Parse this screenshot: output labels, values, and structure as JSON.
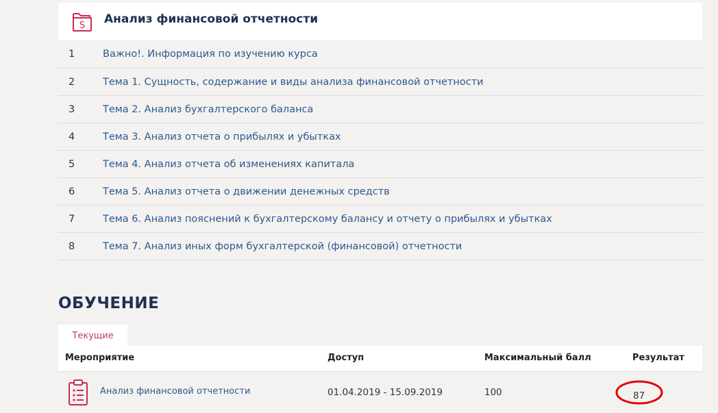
{
  "course": {
    "title": "Анализ финансовой отчетности",
    "icon": "course-s-icon",
    "accent": "#d0274c"
  },
  "topics": [
    {
      "num": "1",
      "label": "Важно!. Информация по изучению курса"
    },
    {
      "num": "2",
      "label": "Тема 1. Сущность, содержание и виды анализа финансовой отчетности"
    },
    {
      "num": "3",
      "label": "Тема 2. Анализ бухгалтерского баланса"
    },
    {
      "num": "4",
      "label": "Тема 3. Анализ отчета о прибылях и убытках"
    },
    {
      "num": "5",
      "label": "Тема 4. Анализ отчета об изменениях капитала"
    },
    {
      "num": "6",
      "label": "Тема 5. Анализ отчета о движении денежных средств"
    },
    {
      "num": "7",
      "label": "Тема 6. Анализ пояснений к бухгалтерскому балансу и отчету о прибылях и убытках"
    },
    {
      "num": "8",
      "label": "Тема 7. Анализ иных форм бухгалтерской (финансовой) отчетности"
    }
  ],
  "learning": {
    "section_title": "ОБУЧЕНИЕ",
    "tab_label": "Текущие",
    "columns": {
      "event": "Мероприятие",
      "access": "Доступ",
      "max_score": "Максимальный балл",
      "result": "Результат"
    },
    "rows": [
      {
        "event": "Анализ финансовой отчетности",
        "access": "01.04.2019 - 15.09.2019",
        "max_score": "100",
        "result": "87",
        "icon": "clipboard-list-icon"
      }
    ]
  },
  "colors": {
    "link": "#2b5a8c",
    "heading": "#1f3152",
    "tab_text": "#c43c5a",
    "highlight_circle": "#e00000"
  }
}
